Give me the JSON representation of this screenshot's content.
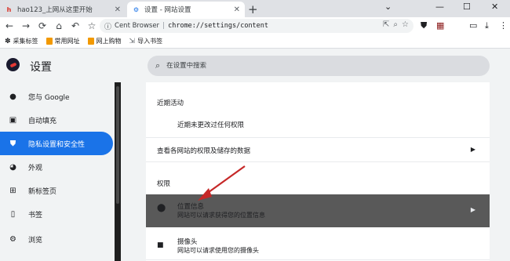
{
  "tabs": [
    {
      "title": "hao123_上网从这里开始",
      "icon": "hao123-icon"
    },
    {
      "title": "设置 - 网站设置",
      "icon": "settings-icon"
    }
  ],
  "toolbar": {
    "site_name": "Cent Browser",
    "url": "chrome://settings/content"
  },
  "bookmarks": [
    {
      "label": "采集标签",
      "color": "#202124"
    },
    {
      "label": "常用网址",
      "color": "#f29900"
    },
    {
      "label": "网上购物",
      "color": "#f29900"
    },
    {
      "label": "导入书签",
      "color": "#5f6368"
    }
  ],
  "header": {
    "title": "设置",
    "search_placeholder": "在设置中搜索"
  },
  "sidebar": {
    "items": [
      {
        "label": "您与 Google",
        "icon": "person-icon"
      },
      {
        "label": "自动填充",
        "icon": "clipboard-icon"
      },
      {
        "label": "隐私设置和安全性",
        "icon": "shield-icon",
        "active": true
      },
      {
        "label": "外观",
        "icon": "palette-icon"
      },
      {
        "label": "新标签页",
        "icon": "new-tab-icon"
      },
      {
        "label": "书签",
        "icon": "bookmark-icon"
      },
      {
        "label": "浏览",
        "icon": "browse-icon"
      }
    ]
  },
  "content": {
    "recent_title": "近期活动",
    "recent_empty": "近期未更改过任何权限",
    "view_permissions": "查看各网站的权限及储存的数据",
    "permissions_title": "权限",
    "location_title": "位置信息",
    "location_desc": "网站可以请求获得您的位置信息",
    "camera_title": "摄像头",
    "camera_desc": "网站可以请求使用您的摄像头"
  },
  "colors": {
    "accent": "#1a73e8",
    "highlight_row": "#595959",
    "annotation_arrow": "#c62828"
  }
}
